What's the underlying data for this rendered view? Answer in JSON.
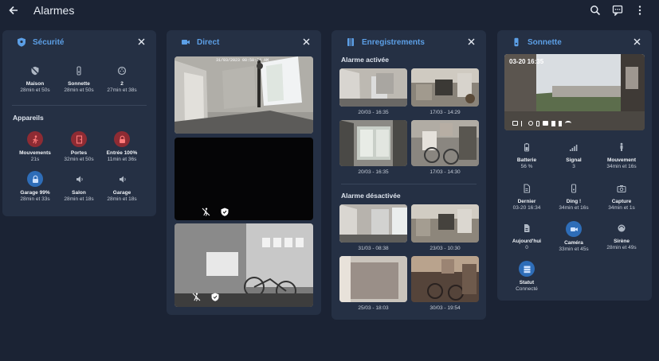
{
  "app": {
    "title": "Alarmes"
  },
  "colors": {
    "background": "#1b2334",
    "card": "#253044",
    "accent": "#5c9fe6",
    "red": "#e05a5a",
    "blue": "#4c8ee0"
  },
  "securite": {
    "title": "Sécurité",
    "status": [
      {
        "label": "Maison",
        "sub": "28min et 50s",
        "icon": "shield-off-icon"
      },
      {
        "label": "Sonnette",
        "sub": "28min et 50s",
        "icon": "doorbell-icon"
      },
      {
        "label": "2",
        "sub": "27min et 38s",
        "icon": "dial-icon"
      }
    ],
    "devices_title": "Appareils",
    "devices": [
      {
        "label": "Mouvements",
        "sub": "21s",
        "icon": "motion-icon",
        "color": "red"
      },
      {
        "label": "Portes",
        "sub": "32min et 50s",
        "icon": "door-icon",
        "color": "red"
      },
      {
        "label": "Entrée 100%",
        "sub": "11min et 36s",
        "icon": "lock-icon",
        "color": "red"
      },
      {
        "label": "Garage 99%",
        "sub": "28min et 33s",
        "icon": "lock-icon",
        "color": "blue"
      },
      {
        "label": "Salon",
        "sub": "28min et 18s",
        "icon": "siren-icon",
        "color": "none"
      },
      {
        "label": "Garage",
        "sub": "28min et 18s",
        "icon": "siren-icon",
        "color": "none"
      }
    ]
  },
  "direct": {
    "title": "Direct",
    "timestamp": "31/03/2023 08:50:24 AM"
  },
  "enregistrements": {
    "title": "Enregistrements",
    "armed_title": "Alarme activée",
    "armed": [
      "20/03 - 16:35",
      "17/03 - 14:29",
      "20/03 - 16:35",
      "17/03 - 14:30"
    ],
    "disarmed_title": "Alarme désactivée",
    "disarmed": [
      "31/03 - 08:38",
      "23/03 - 10:30",
      "25/03 - 18:03",
      "30/03 - 19:54"
    ]
  },
  "sonnette": {
    "title": "Sonnette",
    "snapshot_time": "03-20 16:35",
    "stats": [
      {
        "label": "Batterie",
        "sub": "56 %",
        "icon": "battery-icon",
        "hl": false
      },
      {
        "label": "Signal",
        "sub": "3",
        "icon": "signal-icon",
        "hl": false
      },
      {
        "label": "Mouvement",
        "sub": "34min et 16s",
        "icon": "person-icon",
        "hl": false
      },
      {
        "label": "Dernier",
        "sub": "03-20 16:34",
        "icon": "clock-icon",
        "hl": false
      },
      {
        "label": "Ding !",
        "sub": "34min et 16s",
        "icon": "doorbell-icon",
        "hl": false
      },
      {
        "label": "Capture",
        "sub": "34min et 1s",
        "icon": "camera-icon",
        "hl": false
      },
      {
        "label": "Aujourd'hui",
        "sub": "0",
        "icon": "file-icon",
        "hl": false
      },
      {
        "label": "Caméra",
        "sub": "33min et 45s",
        "icon": "video-icon",
        "hl": true
      },
      {
        "label": "Sirène",
        "sub": "28min et 49s",
        "icon": "siren-icon",
        "hl": false
      },
      {
        "label": "Statut",
        "sub": "Connecté",
        "icon": "server-icon",
        "hl": true
      }
    ]
  }
}
